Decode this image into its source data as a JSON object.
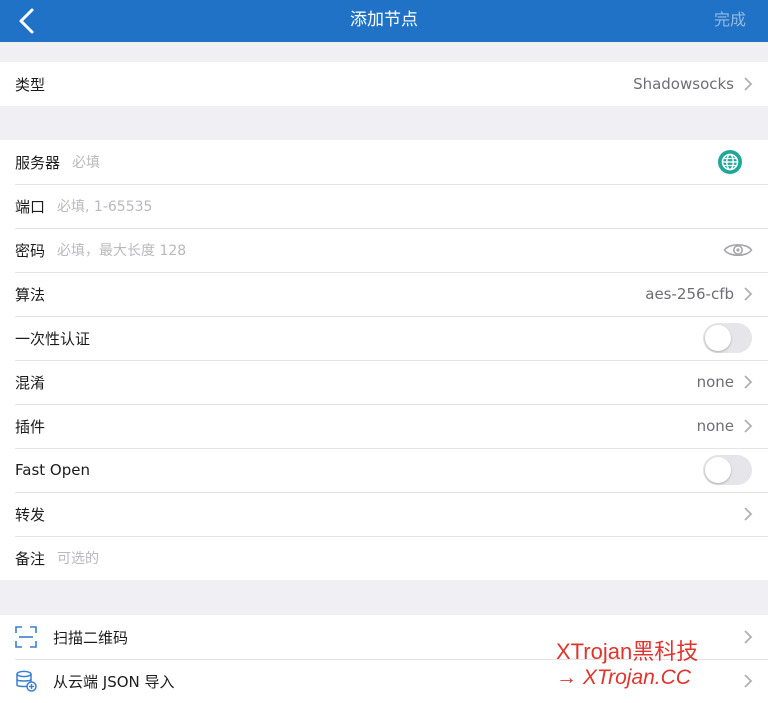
{
  "nav": {
    "title": "添加节点",
    "done_label": "完成"
  },
  "type_row": {
    "label": "类型",
    "value": "Shadowsocks"
  },
  "server_rows": {
    "server": {
      "label": "服务器",
      "placeholder": "必填"
    },
    "port": {
      "label": "端口",
      "placeholder": "必填, 1-65535"
    },
    "password": {
      "label": "密码",
      "placeholder": "必填，最大长度 128"
    },
    "cipher": {
      "label": "算法",
      "value": "aes-256-cfb"
    },
    "one_time_auth": {
      "label": "一次性认证",
      "enabled": false
    },
    "obfs": {
      "label": "混淆",
      "value": "none"
    },
    "plugin": {
      "label": "插件",
      "value": "none"
    },
    "fast_open": {
      "label": "Fast Open",
      "enabled": false
    },
    "forward": {
      "label": "转发"
    },
    "note": {
      "label": "备注",
      "placeholder": "可选的"
    }
  },
  "import_rows": {
    "scan_qr": {
      "label": "扫描二维码"
    },
    "cloud_json": {
      "label": "从云端 JSON 导入"
    }
  },
  "watermark": {
    "line1": "XTrojan黑科技",
    "line2": "→ XTrojan.CC"
  },
  "colors": {
    "nav_bg": "#1f72c6",
    "accent_teal": "#1fa89a",
    "icon_blue": "#3a7fd0",
    "watermark_red": "#e0342e"
  }
}
